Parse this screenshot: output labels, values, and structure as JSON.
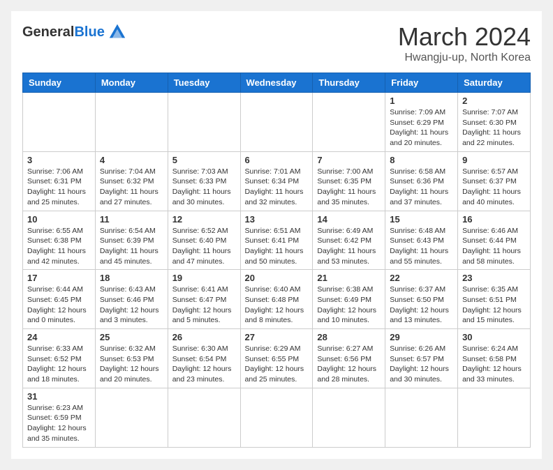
{
  "logo": {
    "general": "General",
    "blue": "Blue"
  },
  "title": "March 2024",
  "subtitle": "Hwangju-up, North Korea",
  "days_of_week": [
    "Sunday",
    "Monday",
    "Tuesday",
    "Wednesday",
    "Thursday",
    "Friday",
    "Saturday"
  ],
  "weeks": [
    [
      {
        "day": "",
        "info": ""
      },
      {
        "day": "",
        "info": ""
      },
      {
        "day": "",
        "info": ""
      },
      {
        "day": "",
        "info": ""
      },
      {
        "day": "",
        "info": ""
      },
      {
        "day": "1",
        "info": "Sunrise: 7:09 AM\nSunset: 6:29 PM\nDaylight: 11 hours and 20 minutes."
      },
      {
        "day": "2",
        "info": "Sunrise: 7:07 AM\nSunset: 6:30 PM\nDaylight: 11 hours and 22 minutes."
      }
    ],
    [
      {
        "day": "3",
        "info": "Sunrise: 7:06 AM\nSunset: 6:31 PM\nDaylight: 11 hours and 25 minutes."
      },
      {
        "day": "4",
        "info": "Sunrise: 7:04 AM\nSunset: 6:32 PM\nDaylight: 11 hours and 27 minutes."
      },
      {
        "day": "5",
        "info": "Sunrise: 7:03 AM\nSunset: 6:33 PM\nDaylight: 11 hours and 30 minutes."
      },
      {
        "day": "6",
        "info": "Sunrise: 7:01 AM\nSunset: 6:34 PM\nDaylight: 11 hours and 32 minutes."
      },
      {
        "day": "7",
        "info": "Sunrise: 7:00 AM\nSunset: 6:35 PM\nDaylight: 11 hours and 35 minutes."
      },
      {
        "day": "8",
        "info": "Sunrise: 6:58 AM\nSunset: 6:36 PM\nDaylight: 11 hours and 37 minutes."
      },
      {
        "day": "9",
        "info": "Sunrise: 6:57 AM\nSunset: 6:37 PM\nDaylight: 11 hours and 40 minutes."
      }
    ],
    [
      {
        "day": "10",
        "info": "Sunrise: 6:55 AM\nSunset: 6:38 PM\nDaylight: 11 hours and 42 minutes."
      },
      {
        "day": "11",
        "info": "Sunrise: 6:54 AM\nSunset: 6:39 PM\nDaylight: 11 hours and 45 minutes."
      },
      {
        "day": "12",
        "info": "Sunrise: 6:52 AM\nSunset: 6:40 PM\nDaylight: 11 hours and 47 minutes."
      },
      {
        "day": "13",
        "info": "Sunrise: 6:51 AM\nSunset: 6:41 PM\nDaylight: 11 hours and 50 minutes."
      },
      {
        "day": "14",
        "info": "Sunrise: 6:49 AM\nSunset: 6:42 PM\nDaylight: 11 hours and 53 minutes."
      },
      {
        "day": "15",
        "info": "Sunrise: 6:48 AM\nSunset: 6:43 PM\nDaylight: 11 hours and 55 minutes."
      },
      {
        "day": "16",
        "info": "Sunrise: 6:46 AM\nSunset: 6:44 PM\nDaylight: 11 hours and 58 minutes."
      }
    ],
    [
      {
        "day": "17",
        "info": "Sunrise: 6:44 AM\nSunset: 6:45 PM\nDaylight: 12 hours and 0 minutes."
      },
      {
        "day": "18",
        "info": "Sunrise: 6:43 AM\nSunset: 6:46 PM\nDaylight: 12 hours and 3 minutes."
      },
      {
        "day": "19",
        "info": "Sunrise: 6:41 AM\nSunset: 6:47 PM\nDaylight: 12 hours and 5 minutes."
      },
      {
        "day": "20",
        "info": "Sunrise: 6:40 AM\nSunset: 6:48 PM\nDaylight: 12 hours and 8 minutes."
      },
      {
        "day": "21",
        "info": "Sunrise: 6:38 AM\nSunset: 6:49 PM\nDaylight: 12 hours and 10 minutes."
      },
      {
        "day": "22",
        "info": "Sunrise: 6:37 AM\nSunset: 6:50 PM\nDaylight: 12 hours and 13 minutes."
      },
      {
        "day": "23",
        "info": "Sunrise: 6:35 AM\nSunset: 6:51 PM\nDaylight: 12 hours and 15 minutes."
      }
    ],
    [
      {
        "day": "24",
        "info": "Sunrise: 6:33 AM\nSunset: 6:52 PM\nDaylight: 12 hours and 18 minutes."
      },
      {
        "day": "25",
        "info": "Sunrise: 6:32 AM\nSunset: 6:53 PM\nDaylight: 12 hours and 20 minutes."
      },
      {
        "day": "26",
        "info": "Sunrise: 6:30 AM\nSunset: 6:54 PM\nDaylight: 12 hours and 23 minutes."
      },
      {
        "day": "27",
        "info": "Sunrise: 6:29 AM\nSunset: 6:55 PM\nDaylight: 12 hours and 25 minutes."
      },
      {
        "day": "28",
        "info": "Sunrise: 6:27 AM\nSunset: 6:56 PM\nDaylight: 12 hours and 28 minutes."
      },
      {
        "day": "29",
        "info": "Sunrise: 6:26 AM\nSunset: 6:57 PM\nDaylight: 12 hours and 30 minutes."
      },
      {
        "day": "30",
        "info": "Sunrise: 6:24 AM\nSunset: 6:58 PM\nDaylight: 12 hours and 33 minutes."
      }
    ],
    [
      {
        "day": "31",
        "info": "Sunrise: 6:23 AM\nSunset: 6:59 PM\nDaylight: 12 hours and 35 minutes."
      },
      {
        "day": "",
        "info": ""
      },
      {
        "day": "",
        "info": ""
      },
      {
        "day": "",
        "info": ""
      },
      {
        "day": "",
        "info": ""
      },
      {
        "day": "",
        "info": ""
      },
      {
        "day": "",
        "info": ""
      }
    ]
  ]
}
